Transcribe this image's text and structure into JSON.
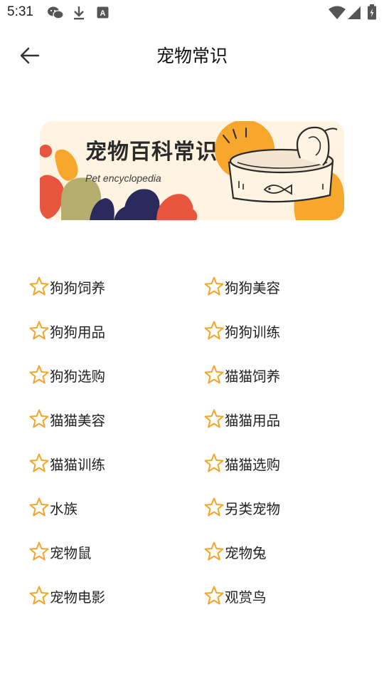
{
  "status": {
    "time": "5:31"
  },
  "header": {
    "title": "宠物常识"
  },
  "banner": {
    "title": "宠物百科常识",
    "subtitle": "Pet encyclopedia"
  },
  "topics": [
    {
      "label": "狗狗饲养"
    },
    {
      "label": "狗狗美容"
    },
    {
      "label": "狗狗用品"
    },
    {
      "label": "狗狗训练"
    },
    {
      "label": "狗狗选购"
    },
    {
      "label": "猫猫饲养"
    },
    {
      "label": "猫猫美容"
    },
    {
      "label": "猫猫用品"
    },
    {
      "label": "猫猫训练"
    },
    {
      "label": "猫猫选购"
    },
    {
      "label": "水族"
    },
    {
      "label": "另类宠物"
    },
    {
      "label": "宠物鼠"
    },
    {
      "label": "宠物兔"
    },
    {
      "label": "宠物电影"
    },
    {
      "label": "观赏鸟"
    }
  ],
  "colors": {
    "star": "#f4a52a",
    "banner_bg": "#fff3e2",
    "accent_orange": "#f7a72b",
    "accent_red": "#e8553f",
    "accent_navy": "#2b2a5c",
    "accent_olive": "#b5ad6e"
  }
}
